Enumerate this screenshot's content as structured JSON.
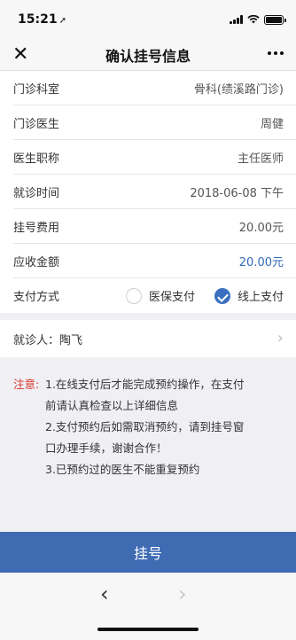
{
  "status_bar": {
    "time": "15:21",
    "location_arrow": "➚"
  },
  "nav": {
    "close": "✕",
    "title": "确认挂号信息"
  },
  "form": {
    "rows": [
      {
        "label": "门诊科室",
        "value": "骨科(绩溪路门诊)"
      },
      {
        "label": "门诊医生",
        "value": "周健"
      },
      {
        "label": "医生职称",
        "value": "主任医师"
      },
      {
        "label": "就诊时间",
        "value": "2018-06-08 下午"
      },
      {
        "label": "挂号费用",
        "value": "20.00元"
      },
      {
        "label": "应收金额",
        "value": "20.00元"
      }
    ],
    "payment": {
      "label": "支付方式",
      "options": [
        {
          "label": "医保支付",
          "selected": false
        },
        {
          "label": "线上支付",
          "selected": true
        }
      ]
    }
  },
  "patient": {
    "label": "就诊人：陶飞"
  },
  "notice": {
    "label": "注意:",
    "lines": [
      "1.在线支付后才能完成预约操作，在支付",
      "前请认真检查以上详细信息",
      "2.支付预约后如需取消预约，请到挂号窗",
      "口办理手续，谢谢合作！",
      "3.已预约过的医生不能重复预约"
    ]
  },
  "submit_button": {
    "label": "挂号"
  },
  "bottom_nav": {
    "back": "‹",
    "forward": "›"
  },
  "colors": {
    "primary": "#3f6bb3",
    "notice_red": "#d9362b",
    "amount_blue": "#2f6bb5"
  }
}
